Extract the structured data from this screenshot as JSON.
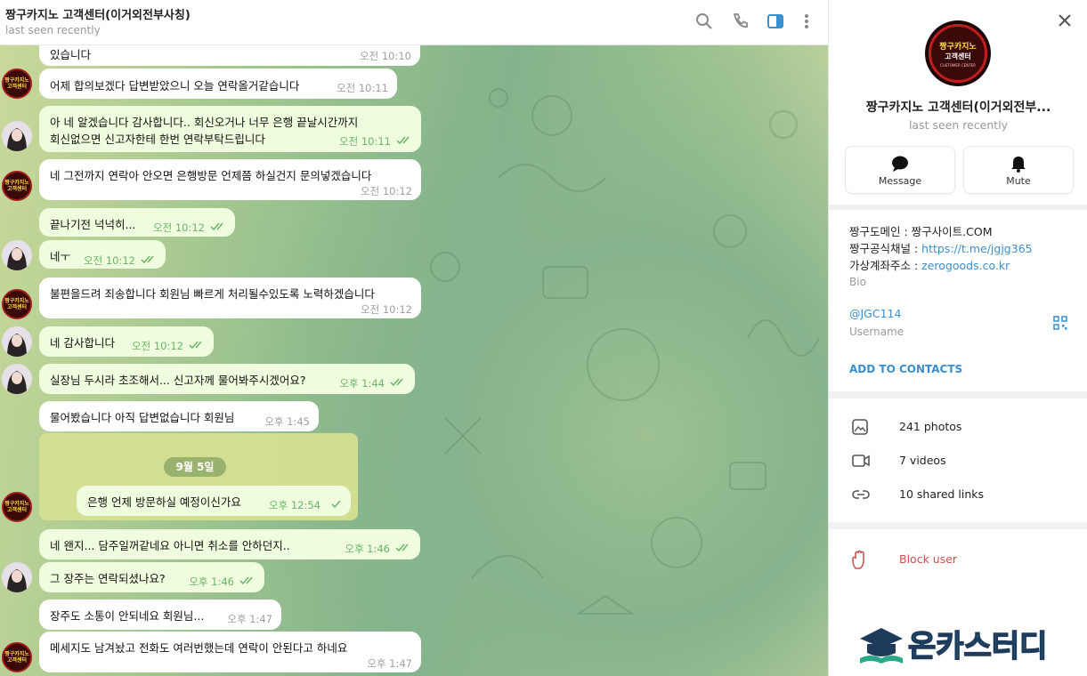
{
  "header": {
    "title": "짱구카지노 고객센터(이거외전부사칭)",
    "status": "last seen recently"
  },
  "messages": [
    {
      "text": "있습니다",
      "time": "오전 10:10"
    },
    {
      "text": "어제 합의보겠다 답변받았으니 오늘 연락올거같습니다",
      "time": "오전 10:11"
    },
    {
      "line1": "아 네 알겠습니다 감사합니다.. 회신오거나 너무 은행 끝날시간까지",
      "line2": "회신없으면 신고자한테 한번 연락부탁드립니다",
      "time": "오전 10:11"
    },
    {
      "text": "네 그전까지 연락아 안오면 은행방문 언제쯤 하실건지 문의넣겠습니다",
      "time": "오전 10:12"
    },
    {
      "text": "끝나기전 넉넉히...",
      "time": "오전 10:12"
    },
    {
      "text": "네ㅜ",
      "time": "오전 10:12"
    },
    {
      "text": "불편을드려 죄송합니다 회원님 빠르게 처리될수있도록 노력하겠습니다",
      "time": "오전 10:12"
    },
    {
      "text": "네 감사합니다",
      "time": "오전 10:12"
    },
    {
      "text": "실장님 두시라 초조해서... 신고자께 물어봐주시겠어요?",
      "time": "오후 1:44"
    },
    {
      "text": "물어봤습니다 아직 답변없습니다 회원님",
      "time": "오후 1:45"
    },
    {
      "date": "9월 5일",
      "text": "은행 언제 방문하실 예정이신가요",
      "time": "오후 12:54"
    },
    {
      "text": "네 왠지... 담주일꺼같네요 아니면 취소를 안하던지..",
      "time": "오후 1:46"
    },
    {
      "text": "그 장주는 연락되셨나요?",
      "time": "오후 1:46"
    },
    {
      "text": "장주도 소통이 안되네요 회원님...",
      "time": "오후 1:47"
    },
    {
      "text": "메세지도 남겨놨고 전화도 여러번했는데 연락이 안된다고 하네요",
      "time": "오후 1:47"
    }
  ],
  "avatar_logo_text": "짱구카지노 고객센터",
  "sidebar": {
    "profile_logo_line1": "짱구카지노",
    "profile_logo_line2": "고객센터",
    "profile_logo_line3": "CUSTOMER CENTER",
    "name": "짱구카지노 고객센터(이거외전부...",
    "status": "last seen recently",
    "message_label": "Message",
    "mute_label": "Mute",
    "bio_line1": "짱구도메인 : 짱구사이트.COM",
    "bio_line2_prefix": "짱구공식채널 : ",
    "bio_line2_link": "https://t.me/jgjg365",
    "bio_line3_prefix": "가상계좌주소 : ",
    "bio_line3_link": "zerogoods.co.kr",
    "bio_label": "Bio",
    "username": "@JGC114",
    "username_label": "Username",
    "add_contacts": "ADD TO CONTACTS",
    "photos": "241 photos",
    "videos": "7 videos",
    "links": "10 shared links",
    "block": "Block user"
  },
  "watermark": "온카스터디",
  "colors": {
    "accent": "#3a8fce",
    "outgoing": "#effdde",
    "danger": "#c94f4f"
  }
}
